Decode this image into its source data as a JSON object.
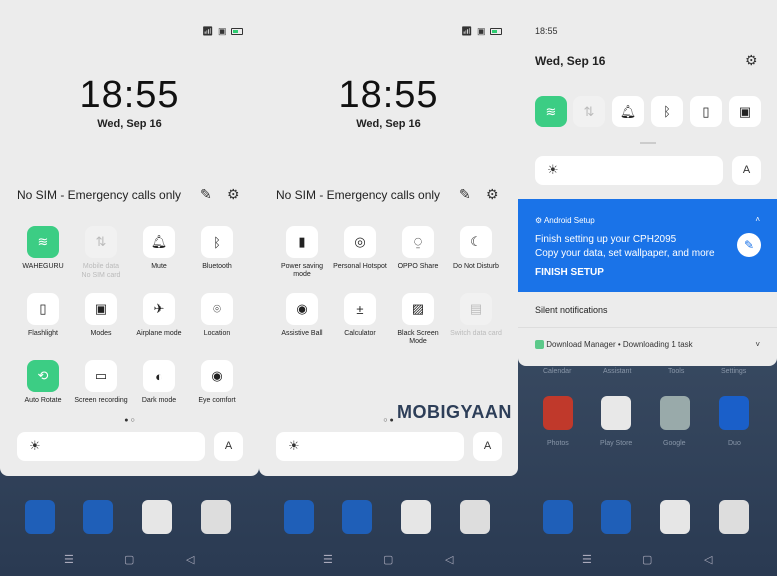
{
  "status": {
    "icons": "wifi signal battery-charging"
  },
  "panel1": {
    "clock": "18:55",
    "date": "Wed, Sep 16",
    "sim": "No SIM - Emergency calls only",
    "tiles": [
      {
        "icon": "wifi-icon",
        "glyph": "≋",
        "label": "WAHEGURU",
        "state": "on"
      },
      {
        "icon": "mobile-data-icon",
        "glyph": "⇅",
        "label": "Mobile data",
        "sub": "No SIM card",
        "state": "dis"
      },
      {
        "icon": "bell-icon",
        "glyph": "🔔︎",
        "label": "Mute",
        "state": "off"
      },
      {
        "icon": "bluetooth-icon",
        "glyph": "ᛒ",
        "label": "Bluetooth",
        "state": "off"
      },
      {
        "icon": "flashlight-icon",
        "glyph": "▯",
        "label": "Flashlight",
        "state": "off"
      },
      {
        "icon": "modes-icon",
        "glyph": "▣",
        "label": "Modes",
        "state": "off"
      },
      {
        "icon": "airplane-icon",
        "glyph": "✈",
        "label": "Airplane mode",
        "state": "off"
      },
      {
        "icon": "location-icon",
        "glyph": "⌾",
        "label": "Location",
        "state": "off"
      },
      {
        "icon": "auto-rotate-icon",
        "glyph": "⟲",
        "label": "Auto Rotate",
        "state": "on"
      },
      {
        "icon": "screen-recording-icon",
        "glyph": "▭",
        "label": "Screen recording",
        "state": "off"
      },
      {
        "icon": "dark-mode-icon",
        "glyph": "◐",
        "label": "Dark mode",
        "state": "off"
      },
      {
        "icon": "eye-comfort-icon",
        "glyph": "◉",
        "label": "Eye comfort",
        "state": "off"
      }
    ],
    "page_indicator": "● ○",
    "auto_label": "A"
  },
  "panel2": {
    "clock": "18:55",
    "date": "Wed, Sep 16",
    "sim": "No SIM - Emergency calls only",
    "tiles": [
      {
        "icon": "battery-saver-icon",
        "glyph": "▮",
        "label": "Power saving mode",
        "state": "off"
      },
      {
        "icon": "hotspot-icon",
        "glyph": "◎",
        "label": "Personal Hotspot",
        "state": "off"
      },
      {
        "icon": "oppo-share-icon",
        "glyph": "⍜",
        "label": "OPPO Share",
        "state": "off"
      },
      {
        "icon": "moon-icon",
        "glyph": "☾",
        "label": "Do Not Disturb",
        "state": "off"
      },
      {
        "icon": "assistive-ball-icon",
        "glyph": "◉",
        "label": "Assistive Ball",
        "state": "off"
      },
      {
        "icon": "calculator-icon",
        "glyph": "±",
        "label": "Calculator",
        "state": "off"
      },
      {
        "icon": "black-screen-icon",
        "glyph": "▨",
        "label": "Black Screen Mode",
        "state": "off"
      },
      {
        "icon": "sim-card-icon",
        "glyph": "▤",
        "label": "Switch data card",
        "state": "dis"
      }
    ],
    "page_indicator": "○ ●",
    "auto_label": "A"
  },
  "panel3": {
    "time": "18:55",
    "date": "Wed, Sep 16",
    "auto_label": "A",
    "notification": {
      "app": "Android Setup",
      "title": "Finish setting up your CPH2095",
      "text": "Copy your data, set wallpaper, and more",
      "action": "FINISH SETUP"
    },
    "silent_header": "Silent notifications",
    "download": "Download Manager • Downloading 1 task",
    "bg_labels": [
      "Calendar",
      "Assistant",
      "Tools",
      "Settings"
    ],
    "bg_apps": [
      "Photos",
      "Play Store",
      "Google",
      "Duo"
    ],
    "accent": "#1a73e8"
  },
  "watermark": "MOBIGYAAN",
  "colors": {
    "active_tile": "#3ccd84",
    "shade": "#ececec",
    "notification": "#1a73e8"
  }
}
